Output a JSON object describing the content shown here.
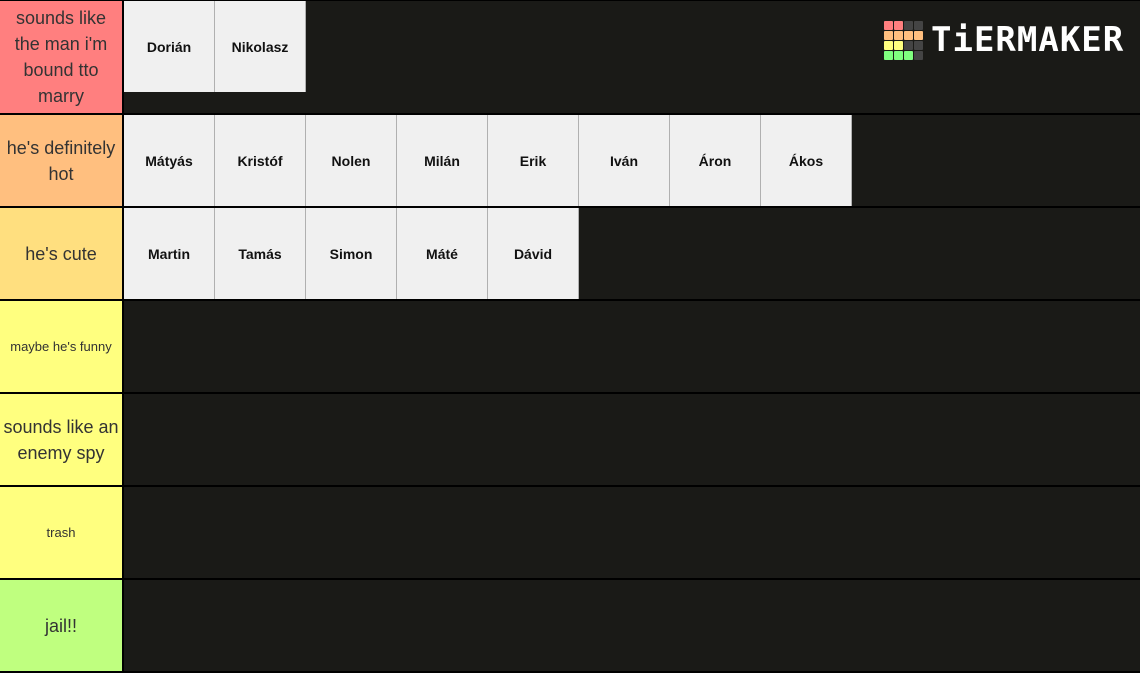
{
  "logo": {
    "text": "TiERMAKER",
    "grid_colors": [
      "#ff7f7f",
      "#ff7f7f",
      "#444",
      "#444",
      "#ffbf7f",
      "#ffbf7f",
      "#ffbf7f",
      "#ffbf7f",
      "#ffff7f",
      "#ffff7f",
      "#444",
      "#444",
      "#7fff7f",
      "#7fff7f",
      "#7fff7f",
      "#444"
    ]
  },
  "tiers": [
    {
      "label": "sounds like the man i'm bound tto marry",
      "color": "#ff7f7f",
      "items": [
        "Dorián",
        "Nikolasz"
      ]
    },
    {
      "label": "he's definitely hot",
      "color": "#ffbf7f",
      "items": [
        "Mátyás",
        "Kristóf",
        "Nolen",
        "Milán",
        "Erik",
        "Iván",
        "Áron",
        "Ákos"
      ]
    },
    {
      "label": "he's cute",
      "color": "#ffdf7f",
      "items": [
        "Martin",
        "Tamás",
        "Simon",
        "Máté",
        "Dávid"
      ]
    },
    {
      "label": "maybe he's funny",
      "color": "#ffff7f",
      "small": true,
      "items": []
    },
    {
      "label": "sounds like an enemy spy",
      "color": "#ffff7f",
      "items": []
    },
    {
      "label": "trash",
      "color": "#ffff7f",
      "small": true,
      "items": []
    },
    {
      "label": "jail!!",
      "color": "#bfff7f",
      "items": []
    }
  ]
}
